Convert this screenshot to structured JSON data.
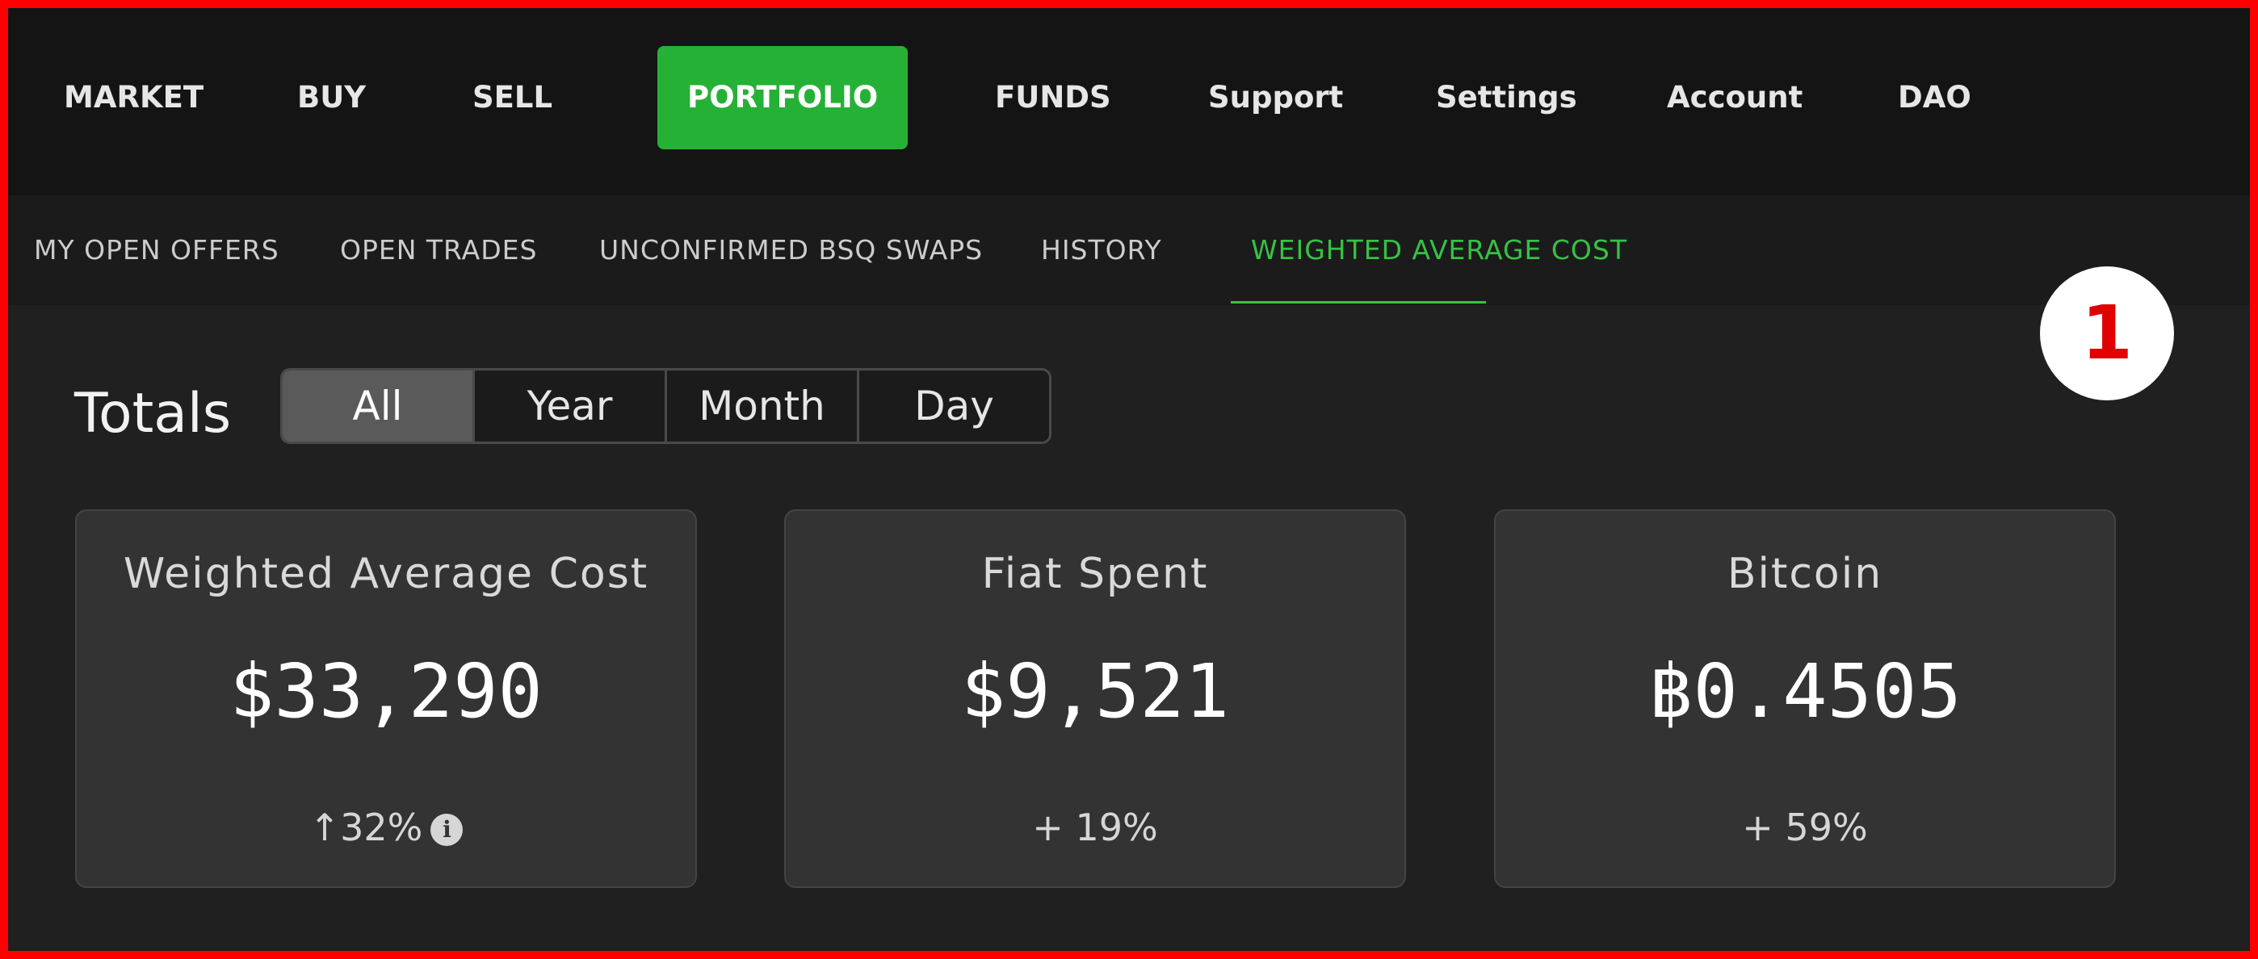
{
  "nav": {
    "items": [
      "MARKET",
      "BUY",
      "SELL",
      "PORTFOLIO",
      "FUNDS",
      "Support",
      "Settings",
      "Account",
      "DAO"
    ],
    "active": "PORTFOLIO"
  },
  "subnav": {
    "items": [
      "MY OPEN OFFERS",
      "OPEN TRADES",
      "UNCONFIRMED BSQ SWAPS",
      "HISTORY",
      "WEIGHTED AVERAGE COST"
    ],
    "active": "WEIGHTED AVERAGE COST"
  },
  "step_badge": "1",
  "totals": {
    "label": "Totals",
    "periods": [
      "All",
      "Year",
      "Month",
      "Day"
    ],
    "selected": "All"
  },
  "cards": [
    {
      "title": "Weighted Average Cost",
      "value": "$33,290",
      "change": "↑32%",
      "has_info_icon": true
    },
    {
      "title": "Fiat Spent",
      "value": "$9,521",
      "change": "+ 19%"
    },
    {
      "title": "Bitcoin",
      "value": "฿0.4505",
      "change": "+ 59%"
    }
  ],
  "icons": {
    "info": "info-circle-icon"
  },
  "colors": {
    "accent_green": "#25b135",
    "active_tab_text": "#36c244",
    "badge_number": "#e00000",
    "frame": "#ff0000"
  }
}
